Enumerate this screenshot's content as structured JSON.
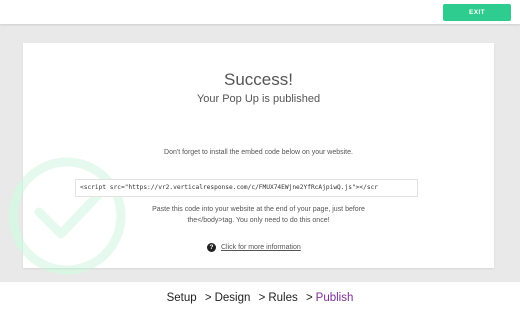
{
  "header": {
    "exit_label": "EXIT"
  },
  "success": {
    "title": "Success!",
    "subtitle": "Your Pop Up is published",
    "instruction": "Don't forget to install the embed code below on your website.",
    "embed_code": "<script src=\"https://vr2.verticalresponse.com/c/FMUX74EWjne2YfRcAjpiwQ.js\"></scr",
    "paste_note_line1": "Paste this code into your website at the end of your page, just before",
    "paste_note_line2": "the</body>tag. You only need to do this once!",
    "info_link": "Click for more information",
    "help_icon_glyph": "?"
  },
  "breadcrumb": {
    "steps": [
      {
        "label": "Setup"
      },
      {
        "label": "Design"
      },
      {
        "label": "Rules"
      },
      {
        "label": "Publish"
      }
    ],
    "separator": ">",
    "active_index": 3
  },
  "colors": {
    "accent": "#2ecc8e",
    "active_step": "#7a2f9a",
    "background": "#e9e9e9",
    "check_watermark": "#d9f5e3"
  },
  "icons": {
    "exit": "none",
    "watermark": "check-circle-icon",
    "help": "question-circle-icon"
  }
}
